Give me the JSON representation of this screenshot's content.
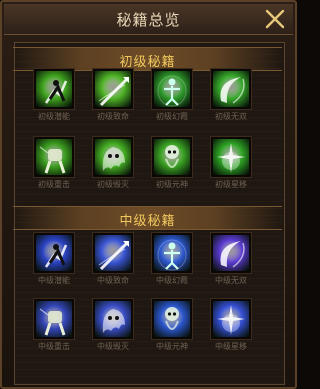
{
  "window": {
    "title": "秘籍总览"
  },
  "sections": {
    "basic": {
      "title": "初级秘籍",
      "items": [
        {
          "label": "初级潜能",
          "icon": "lunge-icon",
          "color": "#3fa31d"
        },
        {
          "label": "初级致命",
          "icon": "arrow-strike-icon",
          "color": "#4fb426"
        },
        {
          "label": "初级幻霞",
          "icon": "spirit-figure-icon",
          "color": "#2e9a2a"
        },
        {
          "label": "初级无双",
          "icon": "crescent-slash-icon",
          "color": "#36a82a"
        },
        {
          "label": "初级重击",
          "icon": "fist-icon",
          "color": "#3b9c1e"
        },
        {
          "label": "初级毁灭",
          "icon": "ghost-claw-icon",
          "color": "#44ad22"
        },
        {
          "label": "初级元神",
          "icon": "skull-spirit-icon",
          "color": "#3aa322"
        },
        {
          "label": "初级星移",
          "icon": "burst-icon",
          "color": "#2ea324"
        }
      ]
    },
    "intermediate": {
      "title": "中级秘籍",
      "items": [
        {
          "label": "中级潜能",
          "icon": "lunge-icon",
          "color": "#2a43c4"
        },
        {
          "label": "中级致命",
          "icon": "arrow-strike-icon",
          "color": "#3a55d6"
        },
        {
          "label": "中级幻霞",
          "icon": "spirit-figure-icon",
          "color": "#2c58d0"
        },
        {
          "label": "中级无双",
          "icon": "crescent-slash-icon",
          "color": "#5a3ad0"
        },
        {
          "label": "中级重击",
          "icon": "fist-icon",
          "color": "#3446b8"
        },
        {
          "label": "中级毁灭",
          "icon": "ghost-claw-icon",
          "color": "#3a4ec8"
        },
        {
          "label": "中级元神",
          "icon": "skull-spirit-icon",
          "color": "#2b56cc"
        },
        {
          "label": "中级星移",
          "icon": "burst-icon",
          "color": "#3550d6"
        }
      ]
    }
  }
}
